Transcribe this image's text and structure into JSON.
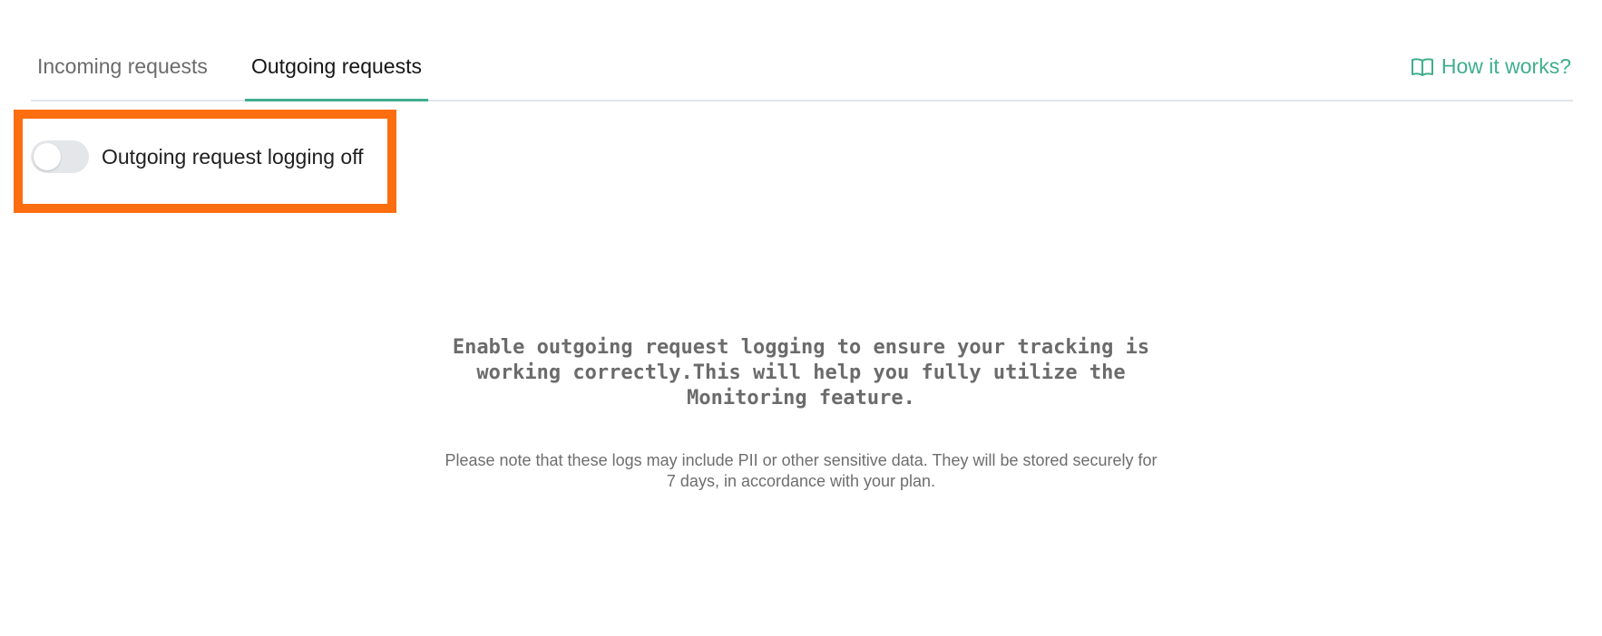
{
  "tabs": [
    {
      "label": "Incoming requests",
      "active": false
    },
    {
      "label": "Outgoing requests",
      "active": true
    }
  ],
  "help_link": {
    "label": "How it works?",
    "icon": "book-open-icon"
  },
  "toggle": {
    "label": "Outgoing request logging off",
    "state": false
  },
  "empty_state": {
    "title": "Enable outgoing request logging to ensure your tracking is working correctly.This will help you fully utilize the Monitoring feature.",
    "note": "Please note that these logs may include PII or other sensitive data. They will be stored securely for 7 days, in accordance with your plan."
  },
  "colors": {
    "accent": "#3fae8c",
    "highlight": "#fc6e10",
    "toggle_off": "#e4e6e9"
  }
}
